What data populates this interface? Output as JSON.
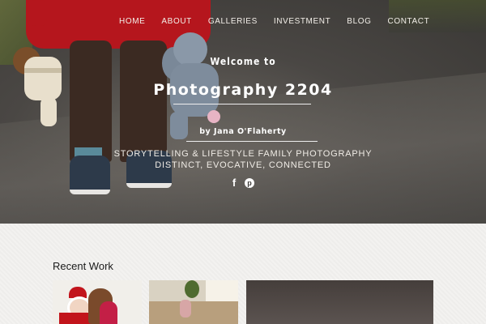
{
  "nav": {
    "items": [
      "HOME",
      "ABOUT",
      "GALLERIES",
      "INVESTMENT",
      "BLOG",
      "CONTACT"
    ]
  },
  "hero": {
    "welcome": "Welcome to",
    "title": "Photography 2204",
    "byline": "by Jana O'Flaherty",
    "tagline1": "STORYTELLING & LIFESTYLE FAMILY PHOTOGRAPHY",
    "tagline2": "DISTINCT, EVOCATIVE, CONNECTED"
  },
  "social": {
    "facebook_glyph": "f",
    "pinterest_glyph": "p"
  },
  "recent": {
    "title": "Recent Work"
  },
  "colors": {
    "accent_red": "#b5161d"
  }
}
